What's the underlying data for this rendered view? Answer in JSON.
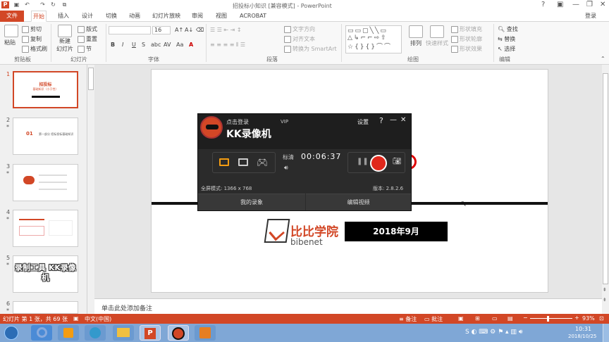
{
  "window": {
    "title": "招投标小知识 [兼容模式] - PowerPoint",
    "help": "?",
    "login": "登录"
  },
  "tabs": [
    "文件",
    "开始",
    "插入",
    "设计",
    "切换",
    "动画",
    "幻灯片放映",
    "审阅",
    "视图",
    "ACROBAT"
  ],
  "ribbon": {
    "clipboard": {
      "paste": "粘贴",
      "cut": "剪切",
      "copy": "复制",
      "format_painter": "格式刷",
      "group": "剪贴板"
    },
    "slides": {
      "new_slide": "新建",
      "new_slide2": "幻灯片",
      "layout": "版式",
      "reset": "重置",
      "section": "节",
      "group": "幻灯片"
    },
    "font": {
      "size": "16",
      "bold": "B",
      "italic": "I",
      "underline": "U",
      "strike": "S",
      "shadow": "abc",
      "spacing": "AV",
      "case": "Aa",
      "color": "A",
      "group": "字体"
    },
    "paragraph": {
      "text_direction": "文字方向",
      "align_text": "对齐文本",
      "smartart": "转换为 SmartArt",
      "group": "段落"
    },
    "drawing": {
      "arrange": "排列",
      "quick_styles": "快速样式",
      "fill": "形状填充",
      "outline": "形状轮廓",
      "effects": "形状效果",
      "group": "绘图"
    },
    "editing": {
      "find": "查找",
      "replace": "替换",
      "select": "选择",
      "group": "编辑"
    }
  },
  "thumbnails": [
    {
      "num": "1",
      "title": "招投标",
      "subtitle": "基础知识（小于性）"
    },
    {
      "num": "2",
      "title": "01",
      "subtitle": "第一部分 招标投标基础知识"
    },
    {
      "num": "3"
    },
    {
      "num": "4"
    },
    {
      "num": "5",
      "overlay": "录制工具 KK录像机"
    },
    {
      "num": "6"
    }
  ],
  "star": "*",
  "slide": {
    "logo_cn": "比比学院",
    "logo_en": "bibenet",
    "date": "2018年9月"
  },
  "notes": "单击此处添加备注",
  "status": {
    "slide": "幻灯片 第 1 张，共 69 张",
    "lang": "中文(中国)",
    "notes": "备注",
    "comments": "批注",
    "zoom": "93%"
  },
  "taskbar": {
    "time": "10:31",
    "date": "2018/10/25"
  },
  "kk": {
    "login": "点击登录",
    "vip": "VIP",
    "settings": "设置",
    "help": "?",
    "minimize": "—",
    "close": "✕",
    "name": "KK录像机",
    "quality": "标清",
    "timer": "00:06:37",
    "fullscreen": "全屏模式: 1366 x 768",
    "version": "版本: 2.8.2.6",
    "my_records": "我的录象",
    "edit_video": "编辑视频"
  }
}
